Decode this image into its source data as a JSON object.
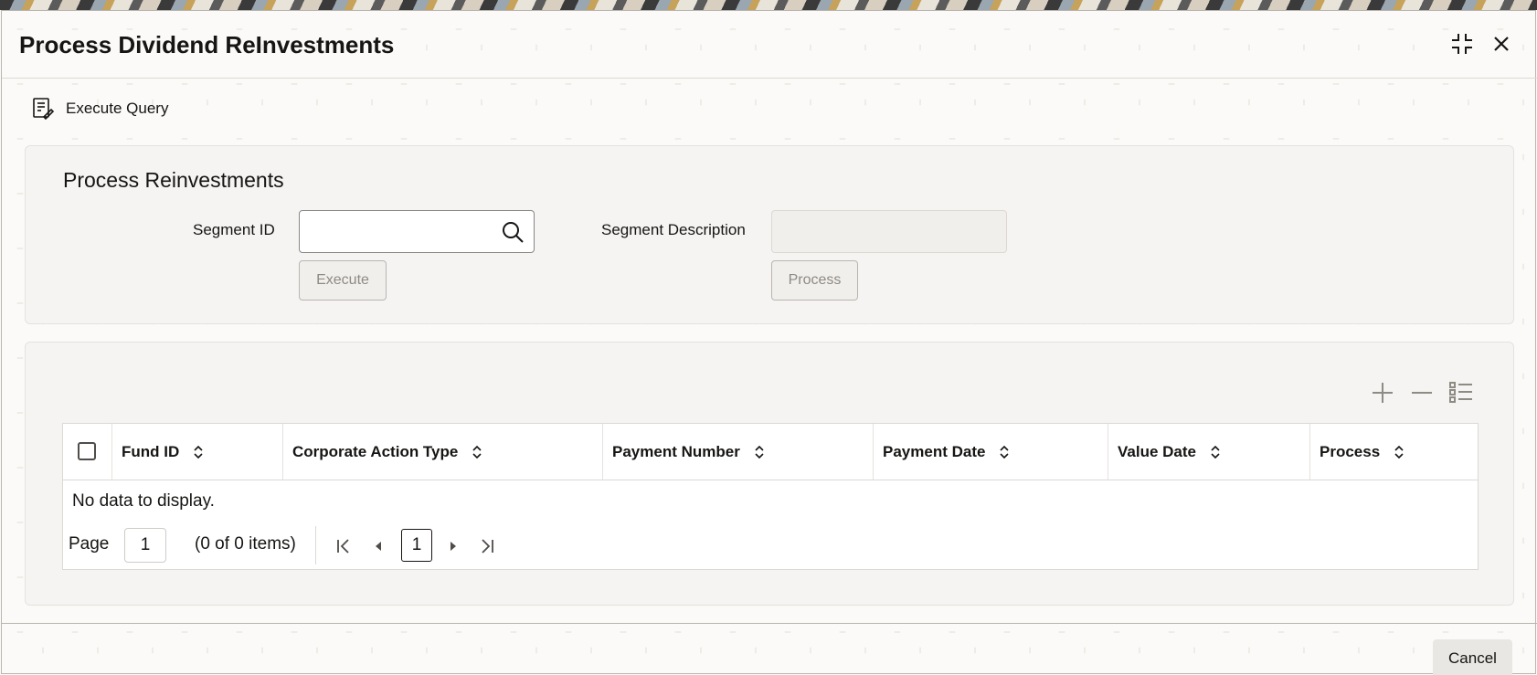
{
  "window": {
    "title": "Process Dividend ReInvestments",
    "maximize_icon": "maximize-icon",
    "close_icon": "close-icon"
  },
  "toolbar": {
    "execute_query_label": "Execute Query",
    "execute_query_icon": "query-document-icon"
  },
  "process_section": {
    "title": "Process Reinvestments",
    "segment_id_label": "Segment ID",
    "segment_id_value": "",
    "segment_description_label": "Segment Description",
    "segment_description_value": "",
    "execute_label": "Execute",
    "process_label": "Process"
  },
  "table": {
    "tools": [
      "add-row-icon",
      "remove-row-icon",
      "column-list-icon"
    ],
    "columns": [
      "Fund ID",
      "Corporate Action Type",
      "Payment Number",
      "Payment Date",
      "Value Date",
      "Process"
    ],
    "rows": [],
    "empty_text": "No data to display.",
    "pagination": {
      "page_label": "Page",
      "page_value": "1",
      "count_text": "(0 of 0 items)",
      "current_page": "1"
    }
  },
  "footer": {
    "cancel_label": "Cancel"
  },
  "colors": {
    "text": "#161513",
    "panel_bg": "#f5f4f2",
    "border": "#b9b6b0",
    "disabled_text": "#8e8a84"
  }
}
